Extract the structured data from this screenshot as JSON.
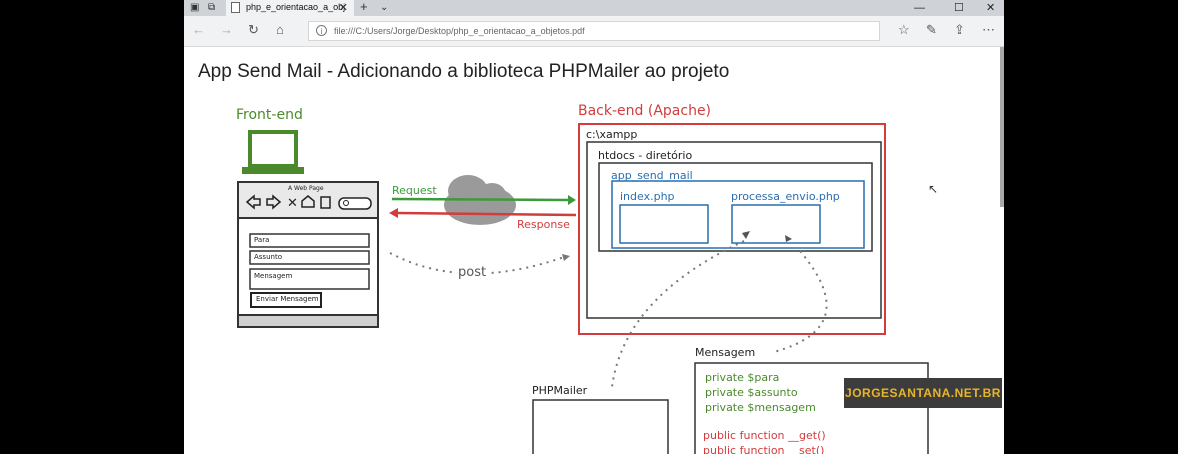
{
  "browser": {
    "tab_title": "php_e_orientacao_a_obj",
    "address": "file:///C:/Users/Jorge/Desktop/php_e_orientacao_a_objetos.pdf",
    "new_tab_glyph": "+",
    "tab_list_glyph": "⌄",
    "icons": [
      "tab-actions-icon",
      "set-aside-tabs-icon",
      "back-icon",
      "forward-icon",
      "refresh-icon",
      "home-icon",
      "info-icon",
      "favorites-icon",
      "notes-icon",
      "share-icon",
      "more-icon"
    ]
  },
  "slide": {
    "title": "App Send Mail - Adicionando a biblioteca PHPMailer ao projeto",
    "frontend": {
      "label": "Front-end",
      "web_page_title": "A Web Page",
      "fields": [
        "Para",
        "Assunto",
        "Mensagem"
      ],
      "button": "Enviar Mensagem"
    },
    "request_label": "Request",
    "response_label": "Response",
    "post_label": "post",
    "backend": {
      "label": "Back-end (Apache)",
      "path": "c:\\xampp",
      "htdocs": "htdocs - diretório",
      "app_folder": "app_send_mail",
      "file1": "index.php",
      "file2": "processa_envio.php"
    },
    "mensagem": {
      "label": "Mensagem",
      "attributes": [
        "private $para",
        "private $assunto",
        "private $mensagem"
      ],
      "methods": [
        "public function __get()",
        "public function __set()"
      ]
    },
    "phpmailer_label": "PHPMailer"
  },
  "overlay": {
    "watermark": "JORGESANTANA.NET.BR"
  },
  "colors": {
    "green": "#4a8a2c",
    "red": "#d23c3c",
    "blue": "#2a6fb0",
    "cloud": "#9a9a9a",
    "watermark_text": "#e8b52a"
  }
}
